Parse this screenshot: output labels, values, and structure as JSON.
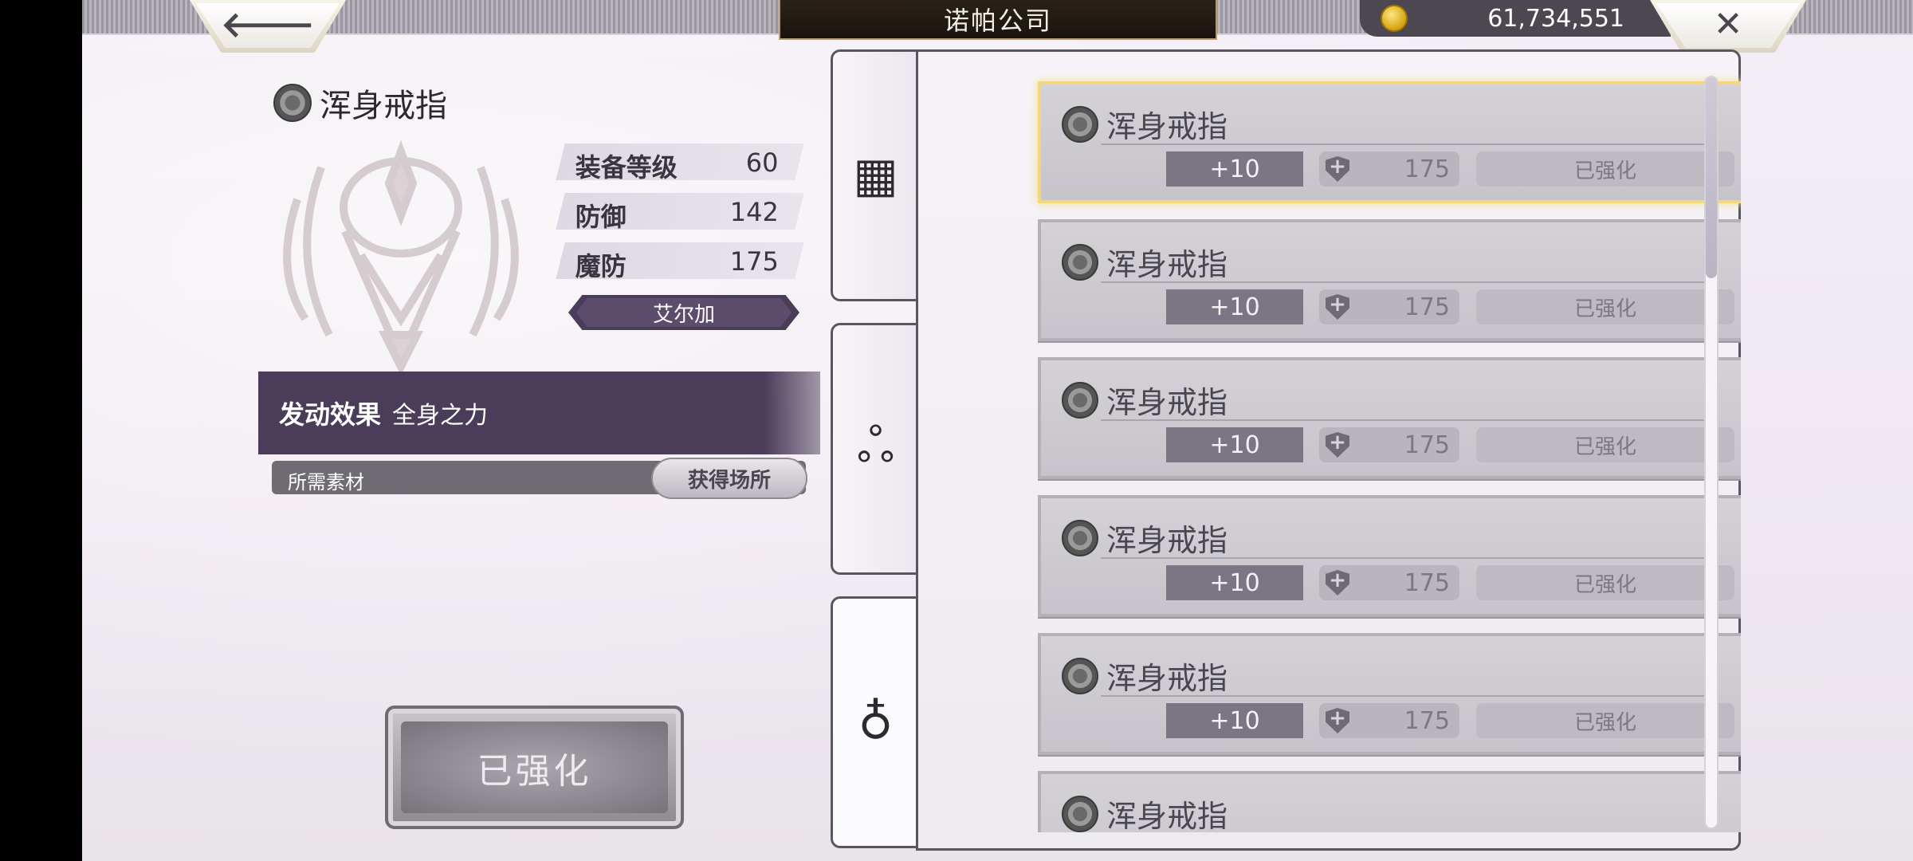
{
  "header": {
    "title": "诺帕公司",
    "currency_value": "61,734,551",
    "back_glyph": "🡐",
    "close_glyph": "✕"
  },
  "item": {
    "name": "浑身戒指",
    "stats": [
      {
        "label": "装备等级",
        "value": "60"
      },
      {
        "label": "防御",
        "value": "142"
      },
      {
        "label": "魔防",
        "value": "175"
      }
    ],
    "character": "艾尔加",
    "effect_label": "发动效果",
    "effect_value": "全身之力",
    "materials_label": "所需素材",
    "obtain_button": "获得场所",
    "action_button": "已强化"
  },
  "tabs": [
    {
      "icon": "bracelet-icon",
      "glyph": "▦"
    },
    {
      "icon": "necklace-icon",
      "glyph": "ஃ"
    },
    {
      "icon": "ring-icon",
      "glyph": "♁"
    }
  ],
  "list": [
    {
      "name": "浑身戒指",
      "plus": "+10",
      "stat": "175",
      "status": "已强化",
      "selected": true
    },
    {
      "name": "浑身戒指",
      "plus": "+10",
      "stat": "175",
      "status": "已强化",
      "selected": false
    },
    {
      "name": "浑身戒指",
      "plus": "+10",
      "stat": "175",
      "status": "已强化",
      "selected": false
    },
    {
      "name": "浑身戒指",
      "plus": "+10",
      "stat": "175",
      "status": "已强化",
      "selected": false
    },
    {
      "name": "浑身戒指",
      "plus": "+10",
      "stat": "175",
      "status": "已强化",
      "selected": false
    },
    {
      "name": "浑身戒指",
      "plus": "",
      "stat": "",
      "status": "",
      "selected": false
    }
  ],
  "scroll_position": 0.0,
  "colors": {
    "accent": "#4a3d5a",
    "selected_border": "#f4d77a",
    "currency": "#d5a20e"
  }
}
